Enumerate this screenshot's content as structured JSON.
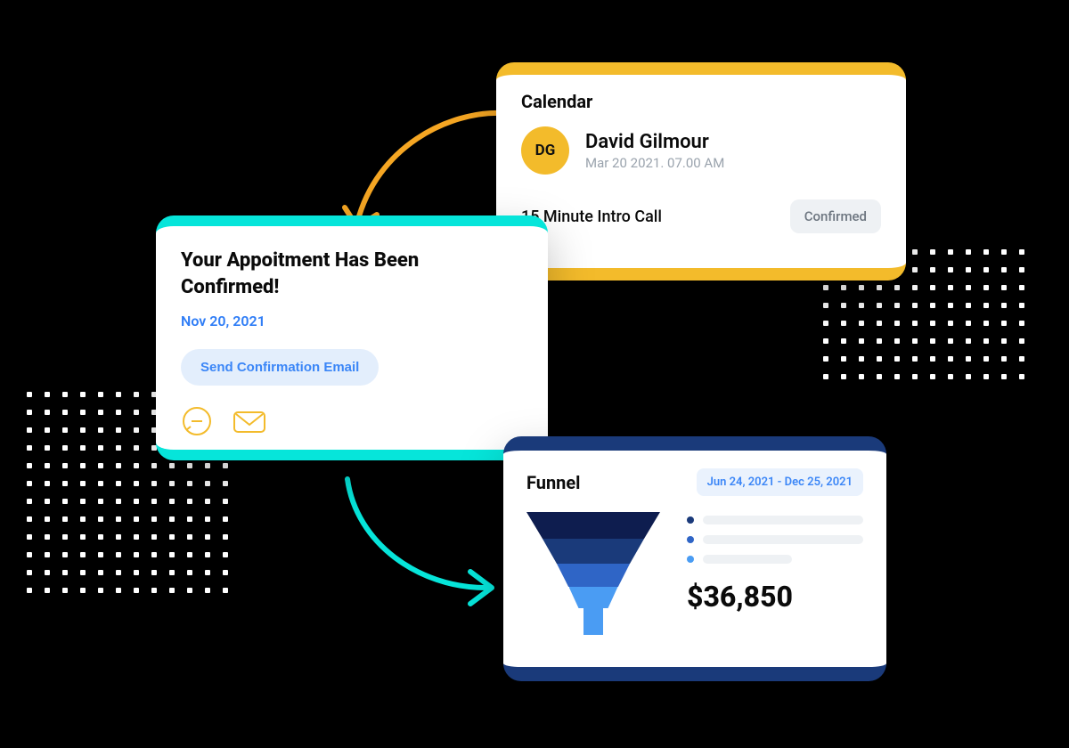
{
  "calendar": {
    "title": "Calendar",
    "contact": {
      "initials": "DG",
      "name": "David Gilmour",
      "datetime": "Mar 20 2021. 07.00 AM"
    },
    "event": {
      "title": "15 Minute Intro Call",
      "status": "Confirmed"
    }
  },
  "appointment": {
    "title": "Your Appoitment Has Been Confirmed!",
    "date": "Nov 20, 2021",
    "button": "Send Confirmation Email"
  },
  "funnel": {
    "title": "Funnel",
    "date_range": "Jun 24, 2021 -  Dec 25, 2021",
    "value": "$36,850"
  },
  "colors": {
    "amber": "#f3bb2b",
    "cyan": "#06e5da",
    "navy": "#1a3a7a",
    "blue": "#3b86f7"
  },
  "chart_data": {
    "type": "funnel",
    "title": "Funnel",
    "date_range": [
      "Jun 24, 2021",
      "Dec 25, 2021"
    ],
    "total_value": 36850,
    "currency": "USD",
    "stages": [
      {
        "color": "#0e1d4f",
        "relative_width": 100
      },
      {
        "color": "#1a3a7a",
        "relative_width": 76
      },
      {
        "color": "#2f65c6",
        "relative_width": 55
      },
      {
        "color": "#4a9cf3",
        "relative_width": 37
      },
      {
        "color": "#4a9cf3",
        "relative_width": 15
      }
    ],
    "legend_items": 3
  }
}
